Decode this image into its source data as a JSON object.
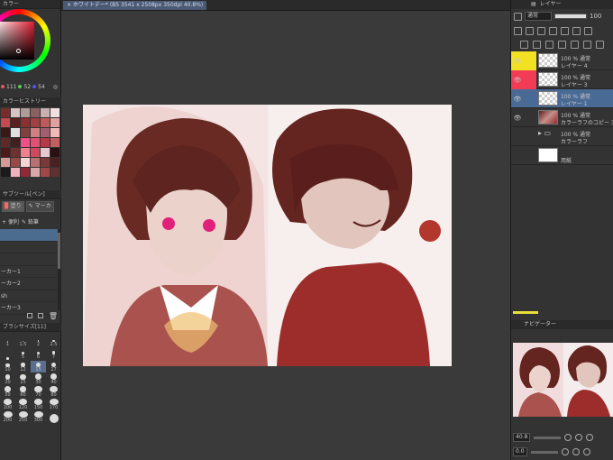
{
  "left_panel": {
    "color_title": "カラー",
    "hsv": {
      "h": "111",
      "s": "52",
      "v": "54"
    },
    "history_title": "カラーヒストリー",
    "swatches": [
      "#7a2b2b",
      "#d8c4c4",
      "#b09a9a",
      "#8a6060",
      "#c8b0b0",
      "#f0e0e0",
      "#c44a50",
      "#5a2020",
      "#8a3030",
      "#a04040",
      "#c05a5a",
      "#e0a0a0",
      "#3a1818",
      "#e0e0e0",
      "#804040",
      "#d08080",
      "#a06070",
      "#f2b8b8",
      "#602828",
      "#402020",
      "#f05088",
      "#e05070",
      "#b83848",
      "#c06060",
      "#501818",
      "#703030",
      "#f08090",
      "#d04860",
      "#e8c8d0",
      "#2a1010",
      "#d89898",
      "#984848",
      "#f4d4d4",
      "#b87070",
      "#7a3838",
      "#4a2020",
      "#1a1a1a",
      "#f0b0c0",
      "#902838",
      "#d8a8a8",
      "#a04848",
      "#603030"
    ],
    "subtool_title": "サブツール[ペン]",
    "subtool_tabs": [
      "塗り",
      "マーカ"
    ],
    "subtool_tabs2": [
      "便利",
      "鉛筆"
    ],
    "brushes": [
      "",
      "",
      "",
      "ーカー1",
      "ーカー2",
      "sh",
      "ーカー3"
    ],
    "brush_size_title": "ブラシサイズ[11]",
    "sizes": [
      "1",
      "1.5",
      "2",
      "2.5",
      "",
      "5",
      "6",
      "7",
      "10",
      "12",
      "15",
      "17",
      "20",
      "25",
      "30",
      "40",
      "50",
      "60",
      "70",
      "80",
      "100",
      "120",
      "150",
      "170",
      "200",
      "250",
      "300",
      ""
    ]
  },
  "canvas": {
    "tab_label": "× ホワイトデー* (B5 3541 x 2508px 350dpi 40.8%)"
  },
  "right_panel": {
    "layer_title": "レイヤー",
    "blend_mode": "通常",
    "opacity": "100",
    "layers": [
      {
        "line1": "100 % 通常",
        "line2": "レイヤー 4",
        "eye": "👁",
        "marker": "yellow",
        "thumb": "check"
      },
      {
        "line1": "100 % 通常",
        "line2": "レイヤー 3",
        "eye": "👁",
        "marker": "red",
        "thumb": "check"
      },
      {
        "line1": "100 % 通常",
        "line2": "レイヤー 1",
        "eye": "👁",
        "marker": "sel",
        "thumb": "check"
      },
      {
        "line1": "100 % 通常",
        "line2": "カラーラフのコピー 3",
        "eye": "👁",
        "marker": "",
        "thumb": "art"
      },
      {
        "line1": "100 % 通常",
        "line2": "カラーラフ",
        "eye": "",
        "marker": "",
        "thumb": "folder"
      },
      {
        "line1": "",
        "line2": "用紙",
        "eye": "",
        "marker": "",
        "thumb": "white"
      }
    ],
    "navigator_title": "ナビゲーター",
    "zoom": "40.8",
    "rotation": "0.0"
  }
}
